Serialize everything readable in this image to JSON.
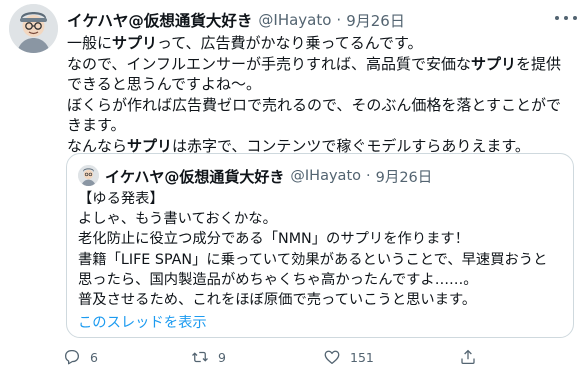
{
  "tweet": {
    "display_name": "イケハヤ@仮想通貨大好き",
    "handle": "@IHayato",
    "separator": "·",
    "date": "9月26日",
    "lines": [
      [
        {
          "t": "一般に"
        },
        {
          "t": "サプリ",
          "b": true
        },
        {
          "t": "って、広告費がかなり乗ってるんです。"
        }
      ],
      [
        {
          "t": "なので、インフルエンサーが手売りすれば、高品質で安価な"
        },
        {
          "t": "サプリ",
          "b": true
        },
        {
          "t": "を提供"
        }
      ],
      [
        {
          "t": "できると思うんですよね〜。"
        }
      ],
      [
        {
          "t": "ぼくらが作れば広告費ゼロで売れるので、そのぶん価格を落とすことがで"
        }
      ],
      [
        {
          "t": "きます。"
        }
      ],
      [
        {
          "t": "なんなら"
        },
        {
          "t": "サプリ",
          "b": true
        },
        {
          "t": "は赤字で、コンテンツで稼ぐモデルすらありえます。"
        }
      ]
    ]
  },
  "quote": {
    "display_name": "イケハヤ@仮想通貨大好き",
    "handle": "@IHayato",
    "separator": "·",
    "date": "9月26日",
    "lines": [
      "【ゆる発表】",
      "よしゃ、もう書いておくかな。",
      "老化防止に役立つ成分である「NMN」のサプリを作ります！",
      "書籍「LIFE SPAN」に乗っていて効果があるということで、早速買おうと",
      "思ったら、国内製造品がめちゃくちゃ高かったんですよ……。",
      "普及させるため、これをほぼ原価で売っていこうと思います。"
    ],
    "thread_link": "このスレッドを表示"
  },
  "actions": {
    "reply_count": "6",
    "retweet_count": "9",
    "like_count": "151"
  },
  "icons": {
    "more": "more-icon",
    "reply": "reply-icon",
    "retweet": "retweet-icon",
    "like": "like-icon",
    "share": "share-icon"
  },
  "colors": {
    "text": "#0f1419",
    "muted": "#536471",
    "link": "#1d9bf0",
    "border": "#cfd9de"
  }
}
